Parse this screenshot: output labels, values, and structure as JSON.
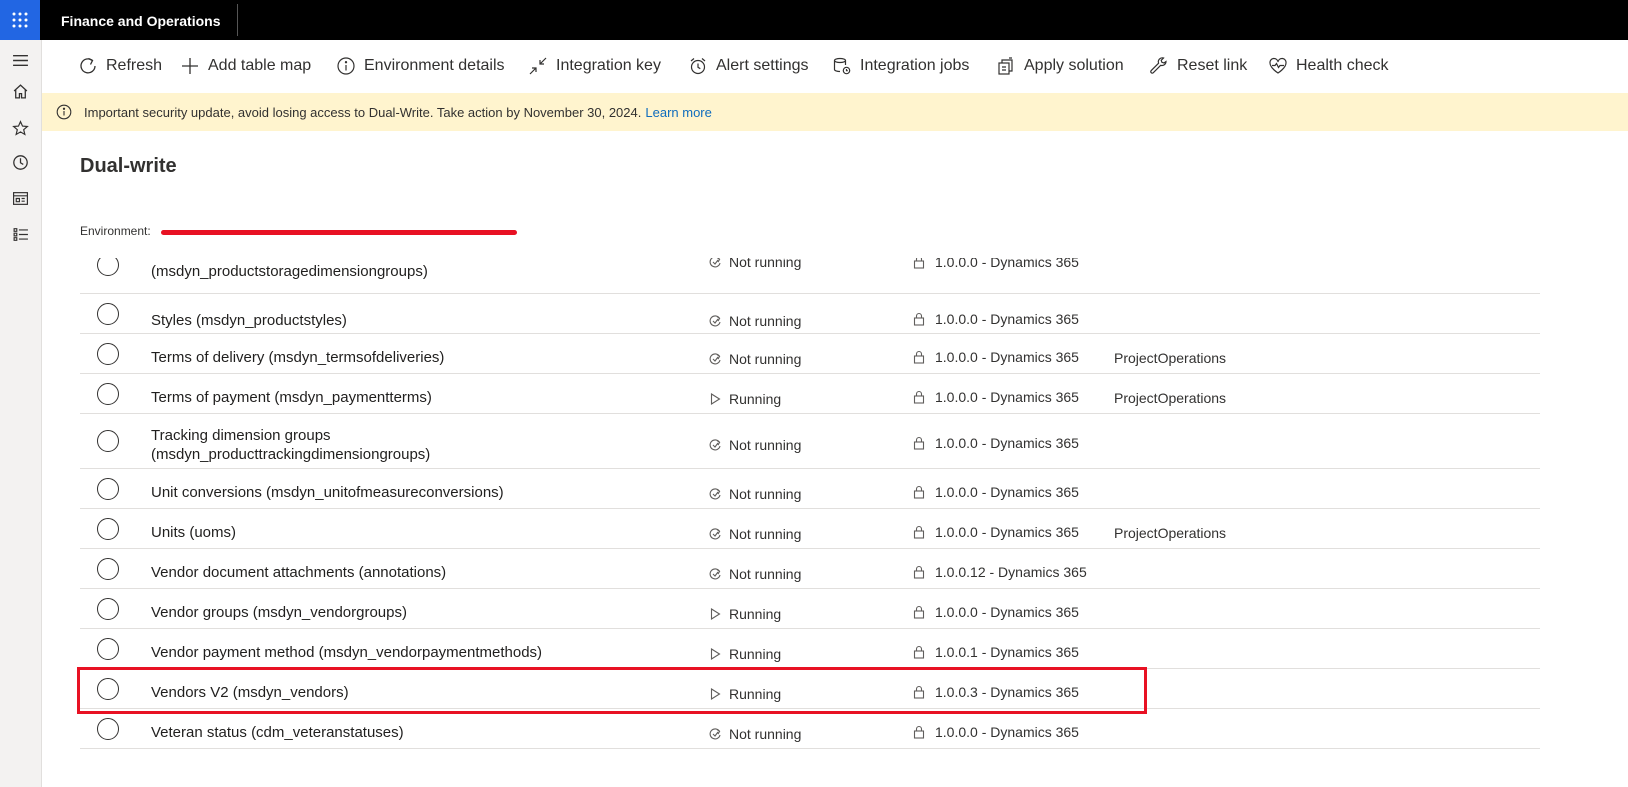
{
  "app": {
    "title": "Finance and Operations"
  },
  "nav": {
    "icons": [
      "hamburger-icon",
      "home-icon",
      "star-icon",
      "clock-icon",
      "workspace-icon",
      "list-icon"
    ]
  },
  "toolbar": {
    "actions": [
      {
        "label": "Refresh",
        "icon": "refresh-icon"
      },
      {
        "label": "Add table map",
        "icon": "plus-icon"
      },
      {
        "label": "Environment details",
        "icon": "info-icon"
      },
      {
        "label": "Integration key",
        "icon": "arrows-icon"
      },
      {
        "label": "Alert settings",
        "icon": "alarm-icon"
      },
      {
        "label": "Integration jobs",
        "icon": "jobs-icon"
      },
      {
        "label": "Apply solution",
        "icon": "apply-icon"
      },
      {
        "label": "Reset link",
        "icon": "wrench-icon"
      },
      {
        "label": "Health check",
        "icon": "heart-icon"
      }
    ]
  },
  "banner": {
    "message": "Important security update, avoid losing access to Dual-Write. Take action by November 30, 2024.",
    "link": "Learn more"
  },
  "page": {
    "title": "Dual-write",
    "environment_label": "Environment:"
  },
  "table": {
    "rows": [
      {
        "name": "(msdyn_productstoragedimensiongroups)",
        "status": "Not running",
        "version": "1.0.0.0 - Dynamics 365",
        "solution": ""
      },
      {
        "name": "Styles (msdyn_productstyles)",
        "status": "Not running",
        "version": "1.0.0.0 - Dynamics 365",
        "solution": ""
      },
      {
        "name": "Terms of delivery (msdyn_termsofdeliveries)",
        "status": "Not running",
        "version": "1.0.0.0 - Dynamics 365",
        "solution": "ProjectOperations"
      },
      {
        "name": "Terms of payment (msdyn_paymentterms)",
        "status": "Running",
        "version": "1.0.0.0 - Dynamics 365",
        "solution": "ProjectOperations"
      },
      {
        "name": "Tracking dimension groups",
        "name2": "(msdyn_producttrackingdimensiongroups)",
        "status": "Not running",
        "version": "1.0.0.0 - Dynamics 365",
        "solution": ""
      },
      {
        "name": "Unit conversions (msdyn_unitofmeasureconversions)",
        "status": "Not running",
        "version": "1.0.0.0 - Dynamics 365",
        "solution": ""
      },
      {
        "name": "Units (uoms)",
        "status": "Not running",
        "version": "1.0.0.0 - Dynamics 365",
        "solution": "ProjectOperations"
      },
      {
        "name": "Vendor document attachments (annotations)",
        "status": "Not running",
        "version": "1.0.0.12 - Dynamics 365",
        "solution": ""
      },
      {
        "name": "Vendor groups (msdyn_vendorgroups)",
        "status": "Running",
        "version": "1.0.0.0 - Dynamics 365",
        "solution": ""
      },
      {
        "name": "Vendor payment method (msdyn_vendorpaymentmethods)",
        "status": "Running",
        "version": "1.0.0.1 - Dynamics 365",
        "solution": ""
      },
      {
        "name": "Vendors V2 (msdyn_vendors)",
        "status": "Running",
        "version": "1.0.0.3 - Dynamics 365",
        "solution": ""
      },
      {
        "name": "Veteran status (cdm_veteranstatuses)",
        "status": "Not running",
        "version": "1.0.0.0 - Dynamics 365",
        "solution": ""
      }
    ]
  },
  "colors": {
    "accent": "#2266e3",
    "banner": "#fff4ce",
    "highlight": "#e81123",
    "link": "#0f6cbd"
  }
}
